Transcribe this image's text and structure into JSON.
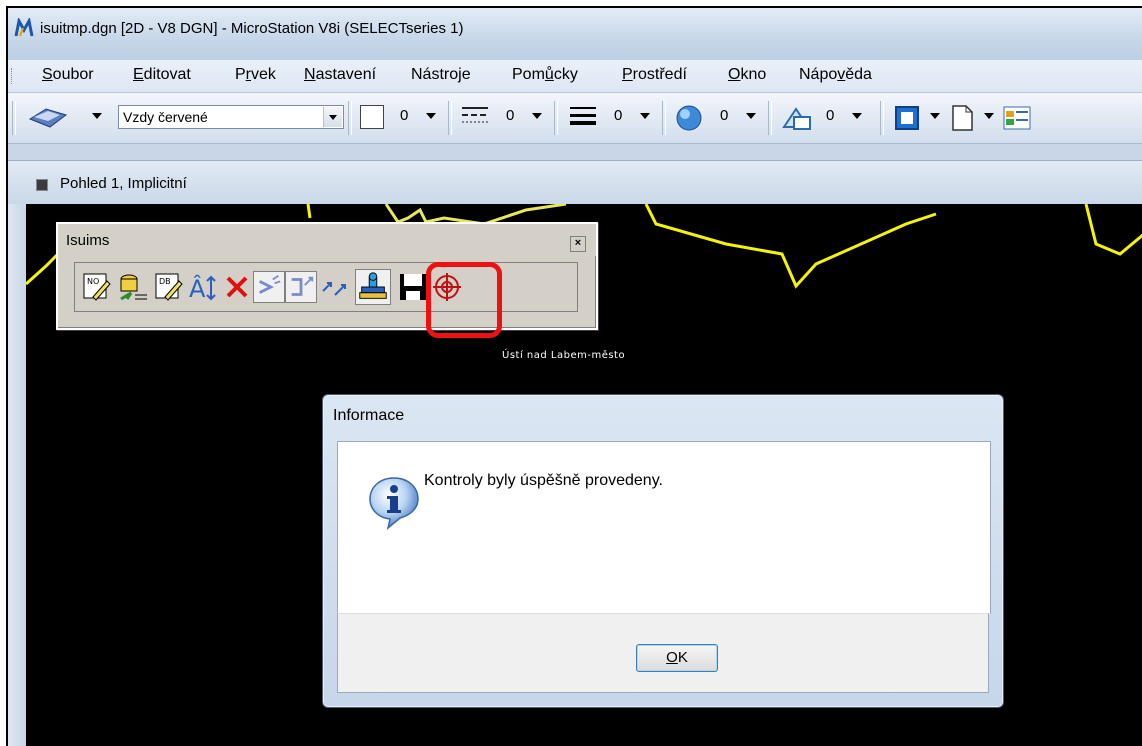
{
  "window": {
    "title": "isuitmp.dgn [2D - V8 DGN] - MicroStation V8i (SELECTseries 1)"
  },
  "menu": {
    "items": [
      {
        "label": "Soubor",
        "key": "S",
        "rest": "oubor"
      },
      {
        "label": "Editovat",
        "key": "E",
        "rest": "ditovat"
      },
      {
        "label": "Prvek",
        "pre": "P",
        "key": "r",
        "rest": "vek"
      },
      {
        "label": "Nastavení",
        "key": "N",
        "rest": "astavení"
      },
      {
        "label": "Nástroje",
        "pre": "Nástro",
        "key": "j",
        "rest": "e"
      },
      {
        "label": "Pomůcky",
        "pre": "Pom",
        "key": "ů",
        "rest": "cky"
      },
      {
        "label": "Prostředí",
        "key": "P",
        "rest": "rostředí"
      },
      {
        "label": "Okno",
        "key": "O",
        "rest": "kno"
      },
      {
        "label": "Nápověda",
        "pre": "Nápo",
        "key": "v",
        "rest": "ěda"
      }
    ]
  },
  "toolbar": {
    "level": "Vzdy červené",
    "color_value": "0",
    "style_value": "0",
    "weight_value": "0",
    "transparency_value": "0",
    "priority_value": "0"
  },
  "view": {
    "title": "Pohled 1, Implicitní",
    "map_label": "Ústí nad Labem-město"
  },
  "toolbox": {
    "title": "Isuims",
    "close": "×"
  },
  "dialog": {
    "title": "Informace",
    "message": "Kontroly byly úspěšně provedeny.",
    "ok_key": "O",
    "ok_rest": "K"
  },
  "colors": {
    "highlight": "#ee1111",
    "map_lines": "#f5f500",
    "view_background": "#000000"
  }
}
